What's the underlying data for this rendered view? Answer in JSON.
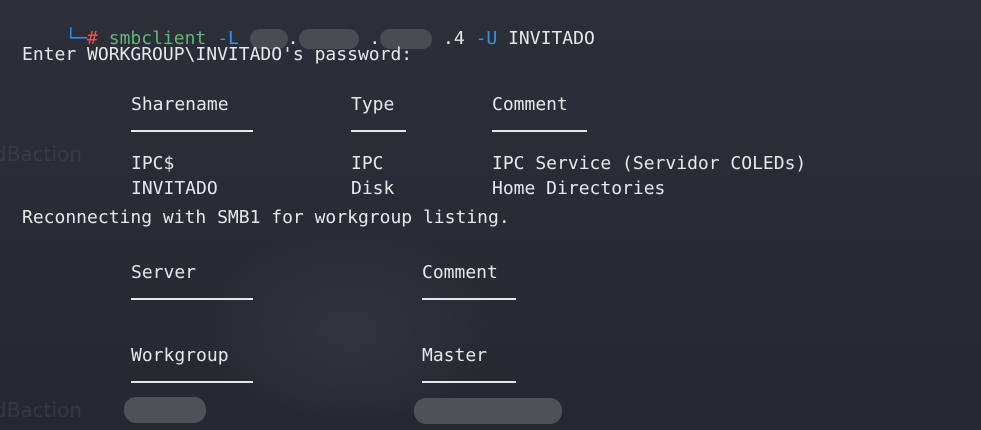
{
  "prompt": {
    "corner": "└─",
    "hash": "#",
    "command": "smbclient",
    "flag_L": "-L",
    "ip_dot1": ".",
    "ip_dot2": ".",
    "ip_tail": ".4",
    "flag_U": "-U",
    "user": "INVITADO"
  },
  "password_prompt": "Enter WORKGROUP\\INVITADO's password:",
  "shares_table": {
    "headers": [
      "Sharename",
      "Type",
      "Comment"
    ],
    "rows": [
      [
        "IPC$",
        "IPC",
        "IPC Service (Servidor COLEDs)"
      ],
      [
        "INVITADO",
        "Disk",
        "Home Directories"
      ]
    ]
  },
  "reconnect_msg": "Reconnecting with SMB1 for workgroup listing.",
  "server_table": {
    "headers": [
      "Server",
      "Comment"
    ]
  },
  "workgroup_table": {
    "headers": [
      "Workgroup",
      "Master"
    ]
  },
  "colors": {
    "background": "#2a2d37",
    "text": "#e8e8ea",
    "prompt_corner": "#3c8fe6",
    "hash": "#ff4a4a"
  }
}
